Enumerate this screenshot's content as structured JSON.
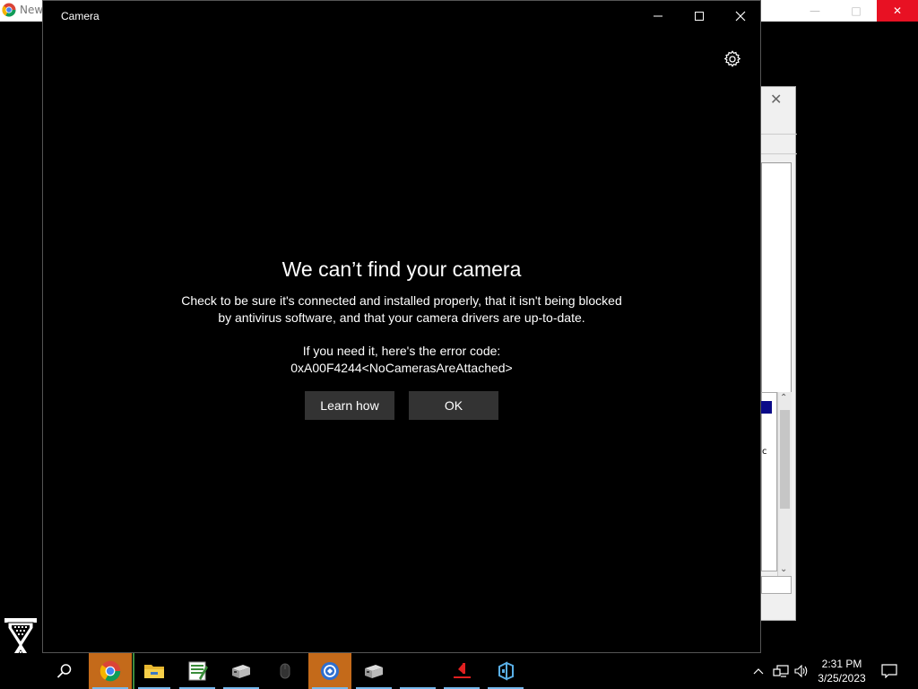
{
  "background_chrome": {
    "tab_title": "New"
  },
  "camera_window": {
    "title": "Camera",
    "heading": "We can’t find your camera",
    "description_line1": "Check to be sure it's connected and installed properly, that it isn't being blocked",
    "description_line2": "by antivirus software, and that your camera drivers are up-to-date.",
    "error_intro": "If you need it, here's the error code:",
    "error_code": "0xA00F4244<NoCamerasAreAttached>",
    "learn_how_label": "Learn how",
    "ok_label": "OK"
  },
  "background_dialog": {
    "partial_text": "c"
  },
  "taskbar": {
    "items": [
      "search-icon",
      "chrome-icon",
      "file-explorer-icon",
      "spreadsheet-icon",
      "network-box-icon",
      "mouse-icon",
      "remote-app-icon",
      "network-box-icon",
      "blank",
      "arrow-app-icon",
      "dev-app-icon"
    ],
    "clock_time": "2:31 PM",
    "clock_date": "3/25/2023"
  },
  "colors": {
    "accent": "#76b9ed",
    "active_tile": "#c46a1a",
    "button_bg": "#333333"
  }
}
